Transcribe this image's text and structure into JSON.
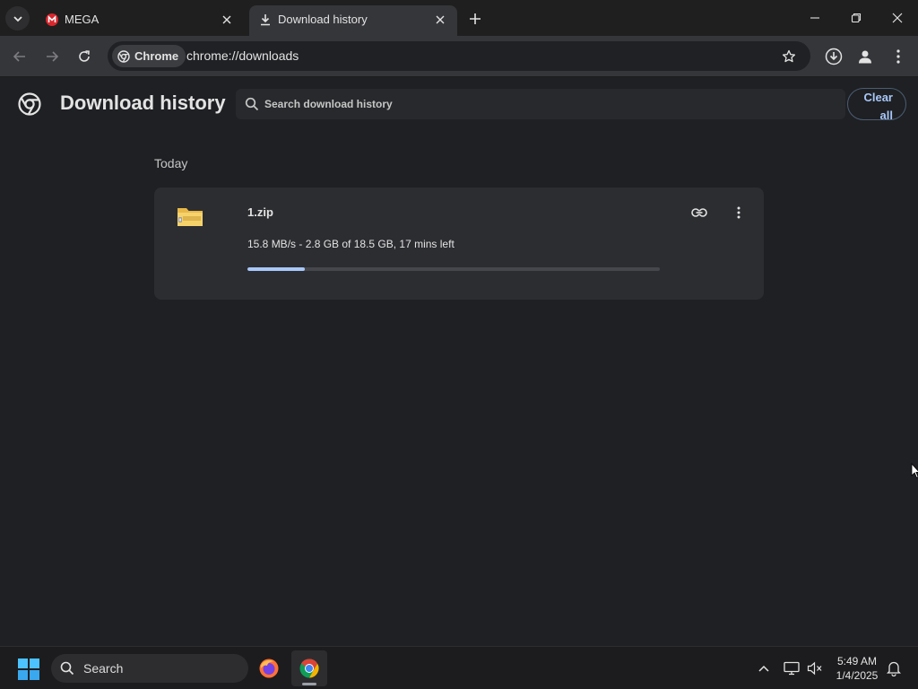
{
  "browser": {
    "tabs": [
      {
        "title": "MEGA",
        "icon": "mega-logo-icon",
        "active": false
      },
      {
        "title": "Download history",
        "icon": "download-icon",
        "active": true
      }
    ],
    "address": {
      "chip_label": "Chrome",
      "url": "chrome://downloads"
    }
  },
  "page": {
    "title": "Download history",
    "search_placeholder": "Search download history",
    "clear_all_line1": "Clear",
    "clear_all_line2": "all",
    "section_label": "Today",
    "downloads": [
      {
        "file_name": "1.zip",
        "status": "15.8 MB/s - 2.8 GB of 18.5 GB, 17 mins left",
        "progress_fraction": 0.14,
        "icon": "zip-folder-icon"
      }
    ]
  },
  "taskbar": {
    "search_label": "Search",
    "time": "5:49 AM",
    "date": "1/4/2025",
    "apps": [
      "firefox-icon",
      "chrome-icon"
    ]
  },
  "colors": {
    "accent": "#a8c7fa",
    "page_bg": "#1f2023",
    "card_bg": "#2c2d31",
    "mega_red": "#d9272e"
  }
}
